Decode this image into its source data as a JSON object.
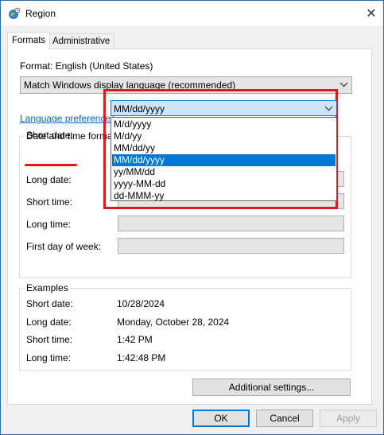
{
  "window": {
    "title": "Region",
    "app_icon": "globe-icon",
    "close_glyph": "✕"
  },
  "tabs": [
    {
      "label": "Formats"
    },
    {
      "label": "Administrative"
    }
  ],
  "format": {
    "label": "Format: English (United States)",
    "selected": "Match Windows display language (recommended)"
  },
  "language_link": "Language preferences",
  "date_time": {
    "group_title": "Date and time formats",
    "short_date_label": "Short date:",
    "long_date_label": "Long date:",
    "short_time_label": "Short time:",
    "long_time_label": "Long time:",
    "first_day_label": "First day of week:",
    "short_date_value": "MM/dd/yyyy",
    "short_date_options": [
      "M/d/yyyy",
      "M/d/yy",
      "MM/dd/yy",
      "MM/dd/yyyy",
      "yy/MM/dd",
      "yyyy-MM-dd",
      "dd-MMM-yy"
    ],
    "selected_index": 3
  },
  "examples": {
    "group_title": "Examples",
    "rows": [
      {
        "label": "Short date:",
        "value": "10/28/2024"
      },
      {
        "label": "Long date:",
        "value": "Monday, October 28, 2024"
      },
      {
        "label": "Short time:",
        "value": "1:42 PM"
      },
      {
        "label": "Long time:",
        "value": "1:42:48 PM"
      }
    ]
  },
  "additional_settings": "Additional settings...",
  "buttons": {
    "ok": "OK",
    "cancel": "Cancel",
    "apply": "Apply"
  },
  "colors": {
    "accent": "#0078d7",
    "highlight": "#e0171f",
    "link": "#0066cc"
  }
}
